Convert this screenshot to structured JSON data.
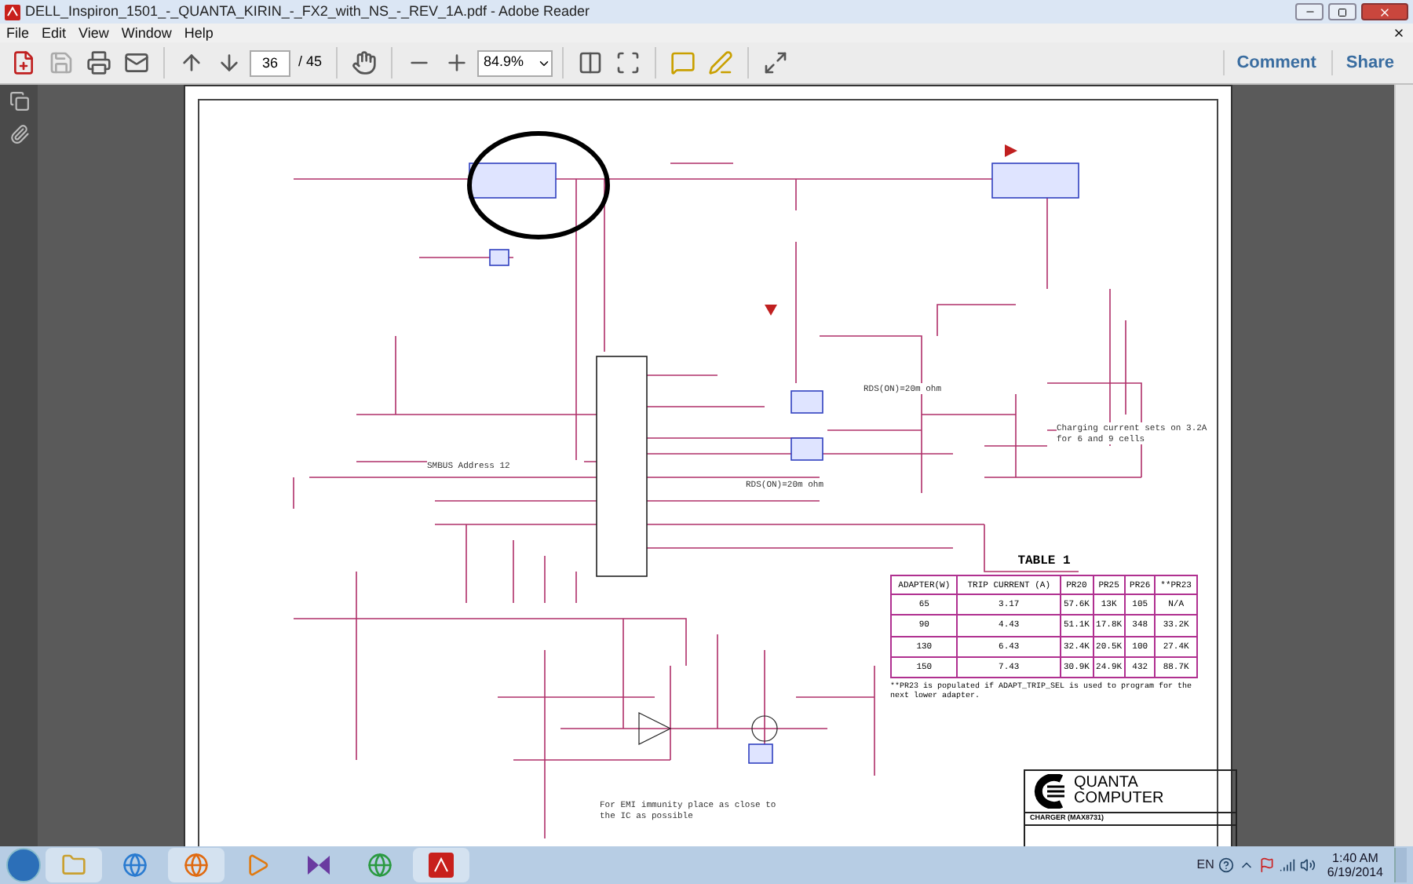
{
  "window": {
    "title": "DELL_Inspiron_1501_-_QUANTA_KIRIN_-_FX2_with_NS_-_REV_1A.pdf - Adobe Reader"
  },
  "menu": [
    "File",
    "Edit",
    "View",
    "Window",
    "Help"
  ],
  "toolbar": {
    "page": "36",
    "page_total": "/ 45",
    "zoom": "84.9%",
    "links": [
      "Comment",
      "Share"
    ]
  },
  "schematic": {
    "labels": [
      "RDS(ON)=20m ohm",
      "RDS(ON)=20m ohm",
      "Charging current sets on 3.2A for 6 and 9 cells",
      "SMBUS Address 12",
      "For EMI immunity place as close to the IC as possible"
    ],
    "table": {
      "title": "TABLE 1",
      "columns": [
        "ADAPTER(W)",
        "TRIP CURRENT (A)",
        "PR20",
        "PR25",
        "PR26",
        "**PR23"
      ],
      "rows": [
        [
          "65",
          "3.17",
          "57.6K",
          "13K",
          "105",
          "N/A"
        ],
        [
          "90",
          "4.43",
          "51.1K",
          "17.8K",
          "348",
          "33.2K"
        ],
        [
          "130",
          "6.43",
          "32.4K",
          "20.5K",
          "100",
          "27.4K"
        ],
        [
          "150",
          "7.43",
          "30.9K",
          "24.9K",
          "432",
          "88.7K"
        ]
      ],
      "note": "**PR23 is populated if ADAPT_TRIP_SEL is used to program for the next lower adapter."
    },
    "title_block": {
      "company": [
        "QUANTA",
        "COMPUTER"
      ],
      "sheet_title": "CHARGER (MAX8731)"
    }
  },
  "taskbar": {
    "language": "EN",
    "time": "1:40 AM",
    "date": "6/19/2014"
  }
}
